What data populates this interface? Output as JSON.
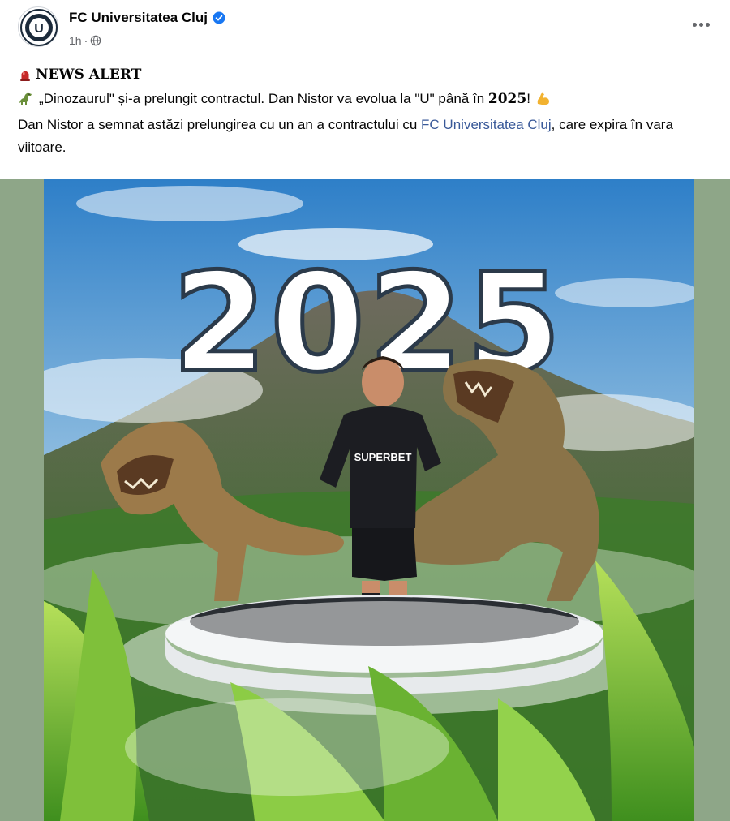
{
  "post": {
    "page_name": "FC Universitatea Cluj",
    "time": "1h",
    "separator": "·",
    "avatar_letter": "U",
    "alert_label": "NEWS ALERT",
    "headline_pre": "„Dinozaurul\" și-a prelungit contractul. Dan Nistor va evolua la \"U\" până în ",
    "headline_year": "2025",
    "headline_post": "!",
    "body_pre": "Dan Nistor a semnat astăzi prelungirea cu un an a contractului cu ",
    "body_mention": "FC Universitatea Cluj",
    "body_post": ", care expira în vara viitoare."
  },
  "poster": {
    "big_text": "2025",
    "jersey_text": "SUPERBET"
  },
  "icons": {
    "verified": "verified-badge-icon",
    "audience": "globe-icon",
    "more": "more-options-icon",
    "alert": "red-alert-icon",
    "dino": "dinosaur-emoji",
    "muscle": "flexed-biceps-emoji"
  },
  "colors": {
    "verified_blue": "#1877f2",
    "mention_blue": "#385898",
    "alert_red": "#c62828",
    "media_bg": "#8ea688"
  }
}
